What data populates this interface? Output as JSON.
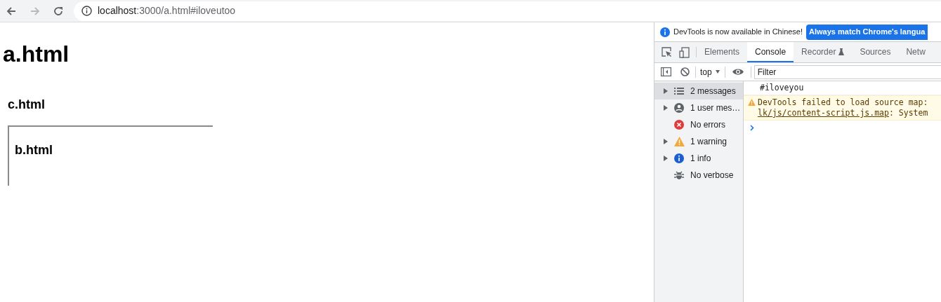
{
  "browser": {
    "address": {
      "host": "localhost",
      "path": ":3000/a.html#iloveutoo"
    }
  },
  "page": {
    "title": "a.html",
    "frame_heading": "c.html",
    "inner_frame_heading": "b.html"
  },
  "devtools": {
    "banner": {
      "text": "DevTools is now available in Chinese!",
      "button": "Always match Chrome's langua"
    },
    "tabs": [
      {
        "label": "Elements",
        "selected": false,
        "kind": "plain"
      },
      {
        "label": "Console",
        "selected": true,
        "kind": "plain"
      },
      {
        "label": "Recorder",
        "selected": false,
        "kind": "experiment"
      },
      {
        "label": "Sources",
        "selected": false,
        "kind": "plain"
      },
      {
        "label": "Netw",
        "selected": false,
        "kind": "plain"
      }
    ],
    "context": "top",
    "filter": {
      "placeholder": "Filter"
    },
    "sidebar": [
      {
        "label": "2 messages",
        "kind": "list",
        "expandable": true,
        "selected": true
      },
      {
        "label": "1 user mes…",
        "kind": "user",
        "expandable": true,
        "selected": false
      },
      {
        "label": "No errors",
        "kind": "error",
        "expandable": false,
        "selected": false
      },
      {
        "label": "1 warning",
        "kind": "warning",
        "expandable": true,
        "selected": false
      },
      {
        "label": "1 info",
        "kind": "info",
        "expandable": true,
        "selected": false
      },
      {
        "label": "No verbose",
        "kind": "verbose",
        "expandable": false,
        "selected": false
      }
    ],
    "messages": [
      {
        "kind": "log",
        "text": "#iloveyou"
      },
      {
        "kind": "warning",
        "text": "DevTools failed to load source map:",
        "link": "lk/js/content-script.js.map",
        "rest": ": System"
      }
    ]
  }
}
